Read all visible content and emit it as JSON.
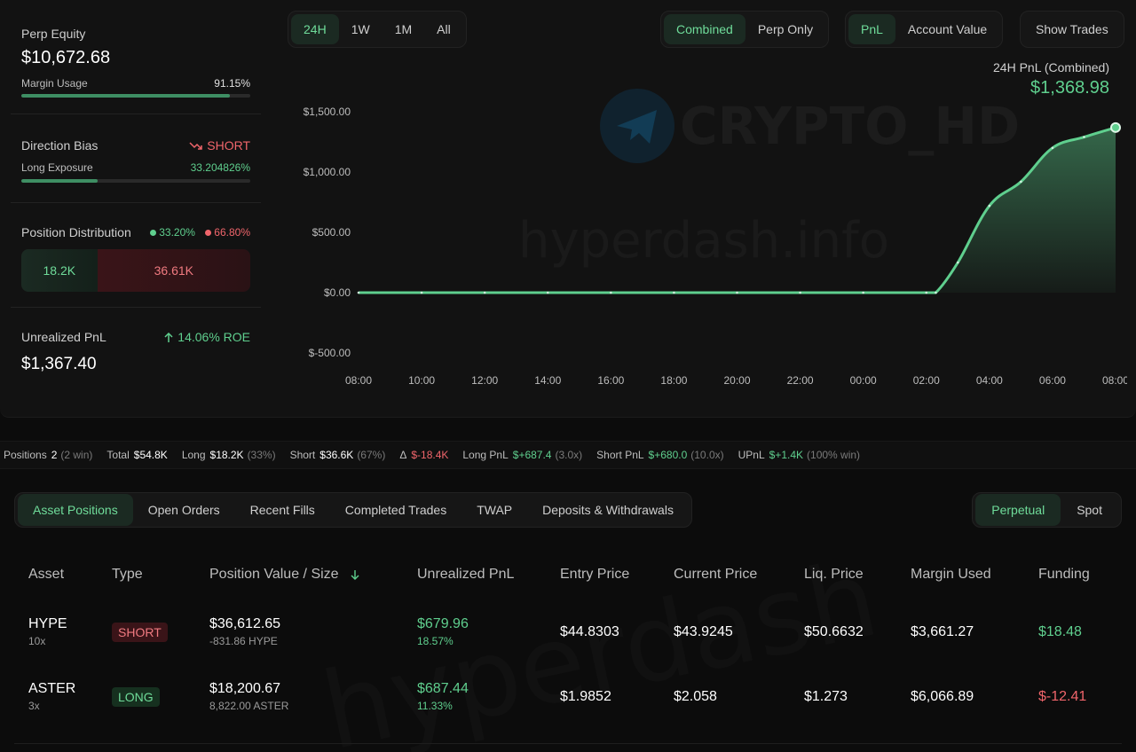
{
  "summary": {
    "perp_equity_label": "Perp Equity",
    "perp_equity_value": "$10,672.68",
    "margin_usage_label": "Margin Usage",
    "margin_usage_value": "91.15%",
    "margin_usage_fraction": 0.9115,
    "direction_bias_label": "Direction Bias",
    "direction_bias_value": "SHORT",
    "long_exposure_label": "Long Exposure",
    "long_exposure_value": "33.204826%",
    "long_exposure_fraction": 0.332,
    "position_distribution_label": "Position Distribution",
    "long_pct": "33.20%",
    "short_pct": "66.80%",
    "long_amount": "18.2K",
    "short_amount": "36.61K",
    "long_fraction": 0.332,
    "unrealized_pnl_label": "Unrealized PnL",
    "roe_value": "14.06% ROE",
    "unrealized_pnl_value": "$1,367.40"
  },
  "range_tabs": [
    {
      "label": "24H",
      "active": true
    },
    {
      "label": "1W",
      "active": false
    },
    {
      "label": "1M",
      "active": false
    },
    {
      "label": "All",
      "active": false
    }
  ],
  "mode_tabs": [
    {
      "label": "Combined",
      "active": true
    },
    {
      "label": "Perp Only",
      "active": false
    }
  ],
  "metric_tabs": [
    {
      "label": "PnL",
      "active": true
    },
    {
      "label": "Account Value",
      "active": false
    }
  ],
  "show_trades_label": "Show Trades",
  "chart_header": {
    "title": "24H PnL (Combined)",
    "value": "$1,368.98"
  },
  "watermarks": {
    "brand": "CRYPTO_HD",
    "site": "hyperdash.info"
  },
  "chart_data": {
    "type": "area",
    "title": "24H PnL (Combined)",
    "x_ticks": [
      "08:00",
      "10:00",
      "12:00",
      "14:00",
      "16:00",
      "18:00",
      "20:00",
      "22:00",
      "00:00",
      "02:00",
      "04:00",
      "06:00",
      "08:00"
    ],
    "y_ticks": [
      "$1,500.00",
      "$1,000.00",
      "$500.00",
      "$0.00",
      "$-500.00"
    ],
    "y_tick_values": [
      1500,
      1000,
      500,
      0,
      -500
    ],
    "ylim": [
      -500,
      1500
    ],
    "x_hours": [
      0,
      2,
      4,
      6,
      8,
      10,
      12,
      14,
      16,
      18,
      18.3,
      19,
      20,
      21,
      22,
      23,
      24
    ],
    "values": [
      0,
      0,
      0,
      0,
      0,
      0,
      0,
      0,
      0,
      0,
      0,
      250,
      720,
      920,
      1200,
      1290,
      1369
    ],
    "color": "#5fcf8e"
  },
  "stats": {
    "positions_label": "Positions",
    "positions_value": "2",
    "positions_note": "(2 win)",
    "total_label": "Total",
    "total_value": "$54.8K",
    "long_label": "Long",
    "long_value": "$18.2K",
    "long_note": "(33%)",
    "short_label": "Short",
    "short_value": "$36.6K",
    "short_note": "(67%)",
    "delta_label": "Δ",
    "delta_value": "$-18.4K",
    "long_pnl_label": "Long PnL",
    "long_pnl_value": "$+687.4",
    "long_pnl_note": "(3.0x)",
    "short_pnl_label": "Short PnL",
    "short_pnl_value": "$+680.0",
    "short_pnl_note": "(10.0x)",
    "upnl_label": "UPnL",
    "upnl_value": "$+1.4K",
    "upnl_note": "(100% win)"
  },
  "position_tabs": [
    {
      "label": "Asset Positions",
      "active": true
    },
    {
      "label": "Open Orders",
      "active": false
    },
    {
      "label": "Recent Fills",
      "active": false
    },
    {
      "label": "Completed Trades",
      "active": false
    },
    {
      "label": "TWAP",
      "active": false
    },
    {
      "label": "Deposits & Withdrawals",
      "active": false
    }
  ],
  "market_tabs": [
    {
      "label": "Perpetual",
      "active": true
    },
    {
      "label": "Spot",
      "active": false
    }
  ],
  "table": {
    "headers": [
      "Asset",
      "Type",
      "Position Value / Size",
      "Unrealized PnL",
      "Entry Price",
      "Current Price",
      "Liq. Price",
      "Margin Used",
      "Funding"
    ],
    "rows": [
      {
        "asset": "HYPE",
        "leverage": "10x",
        "type": "SHORT",
        "value": "$36,612.65",
        "size": "-831.86 HYPE",
        "pnl": "$679.96",
        "pnl_pct": "18.57%",
        "entry": "$44.8303",
        "current": "$43.9245",
        "liq": "$50.6632",
        "margin": "$3,661.27",
        "funding": "$18.48"
      },
      {
        "asset": "ASTER",
        "leverage": "3x",
        "type": "LONG",
        "value": "$18,200.67",
        "size": "8,822.00 ASTER",
        "pnl": "$687.44",
        "pnl_pct": "11.33%",
        "entry": "$1.9852",
        "current": "$2.058",
        "liq": "$1.273",
        "margin": "$6,066.89",
        "funding": "$-12.41"
      }
    ]
  }
}
